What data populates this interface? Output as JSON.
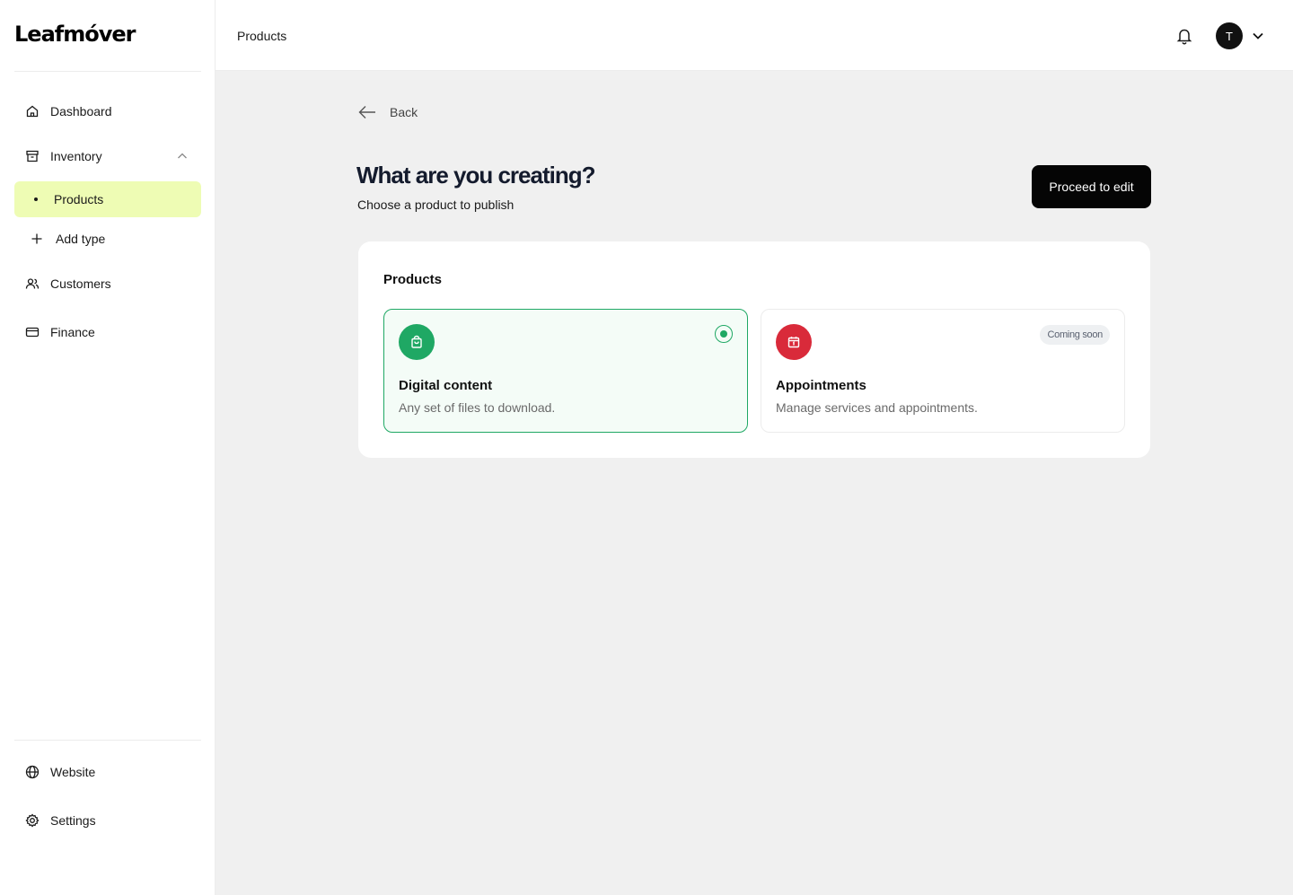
{
  "app": {
    "logo": "Leafmóver"
  },
  "sidebar": {
    "items": [
      {
        "id": "dashboard",
        "label": "Dashboard",
        "icon": "home-icon"
      },
      {
        "id": "inventory",
        "label": "Inventory",
        "icon": "archive-icon"
      },
      {
        "id": "customers",
        "label": "Customers",
        "icon": "users-icon"
      },
      {
        "id": "finance",
        "label": "Finance",
        "icon": "credit-card-icon"
      }
    ],
    "inventory_sub": [
      {
        "label": "Products",
        "active": true
      },
      {
        "label": "Add type",
        "icon": "plus-icon"
      }
    ],
    "bottom": [
      {
        "label": "Website",
        "icon": "globe-icon"
      },
      {
        "label": "Settings",
        "icon": "gear-icon"
      }
    ]
  },
  "header": {
    "breadcrumb": "Products",
    "avatar_initial": "T"
  },
  "main": {
    "back_label": "Back",
    "title": "What are you creating?",
    "subtitle": "Choose a product to publish",
    "proceed_label": "Proceed to edit",
    "panel": {
      "title": "Products",
      "cards": [
        {
          "title": "Digital content",
          "description": "Any set of files to download.",
          "selected": true,
          "icon": "shopping-bag-icon",
          "color": "#1fa864"
        },
        {
          "title": "Appointments",
          "description": "Manage services and appointments.",
          "badge": "Coming soon",
          "icon": "calendar-icon",
          "color": "#d92a3a"
        }
      ]
    }
  },
  "colors": {
    "accent_green": "#1fa864",
    "active_nav_bg": "#eefcb4",
    "primary_button": "#050505",
    "appointments_red": "#d92a3a"
  }
}
